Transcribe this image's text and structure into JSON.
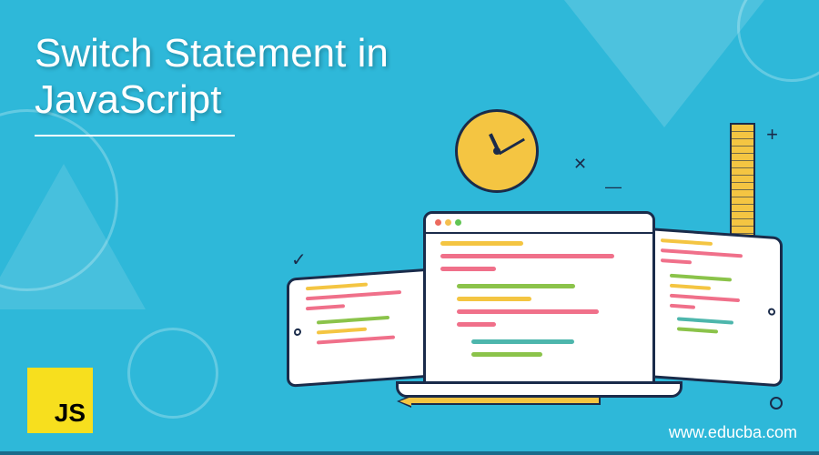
{
  "title_line1": "Switch Statement in",
  "title_line2": "JavaScript",
  "logo_text": "JS",
  "website_url": "www.educba.com",
  "colors": {
    "background": "#2eb8d9",
    "accent_yellow": "#f4c542",
    "outline": "#1a2b4a",
    "code_pink": "#f0708a",
    "code_green": "#8bc34a",
    "code_teal": "#4db6ac"
  }
}
